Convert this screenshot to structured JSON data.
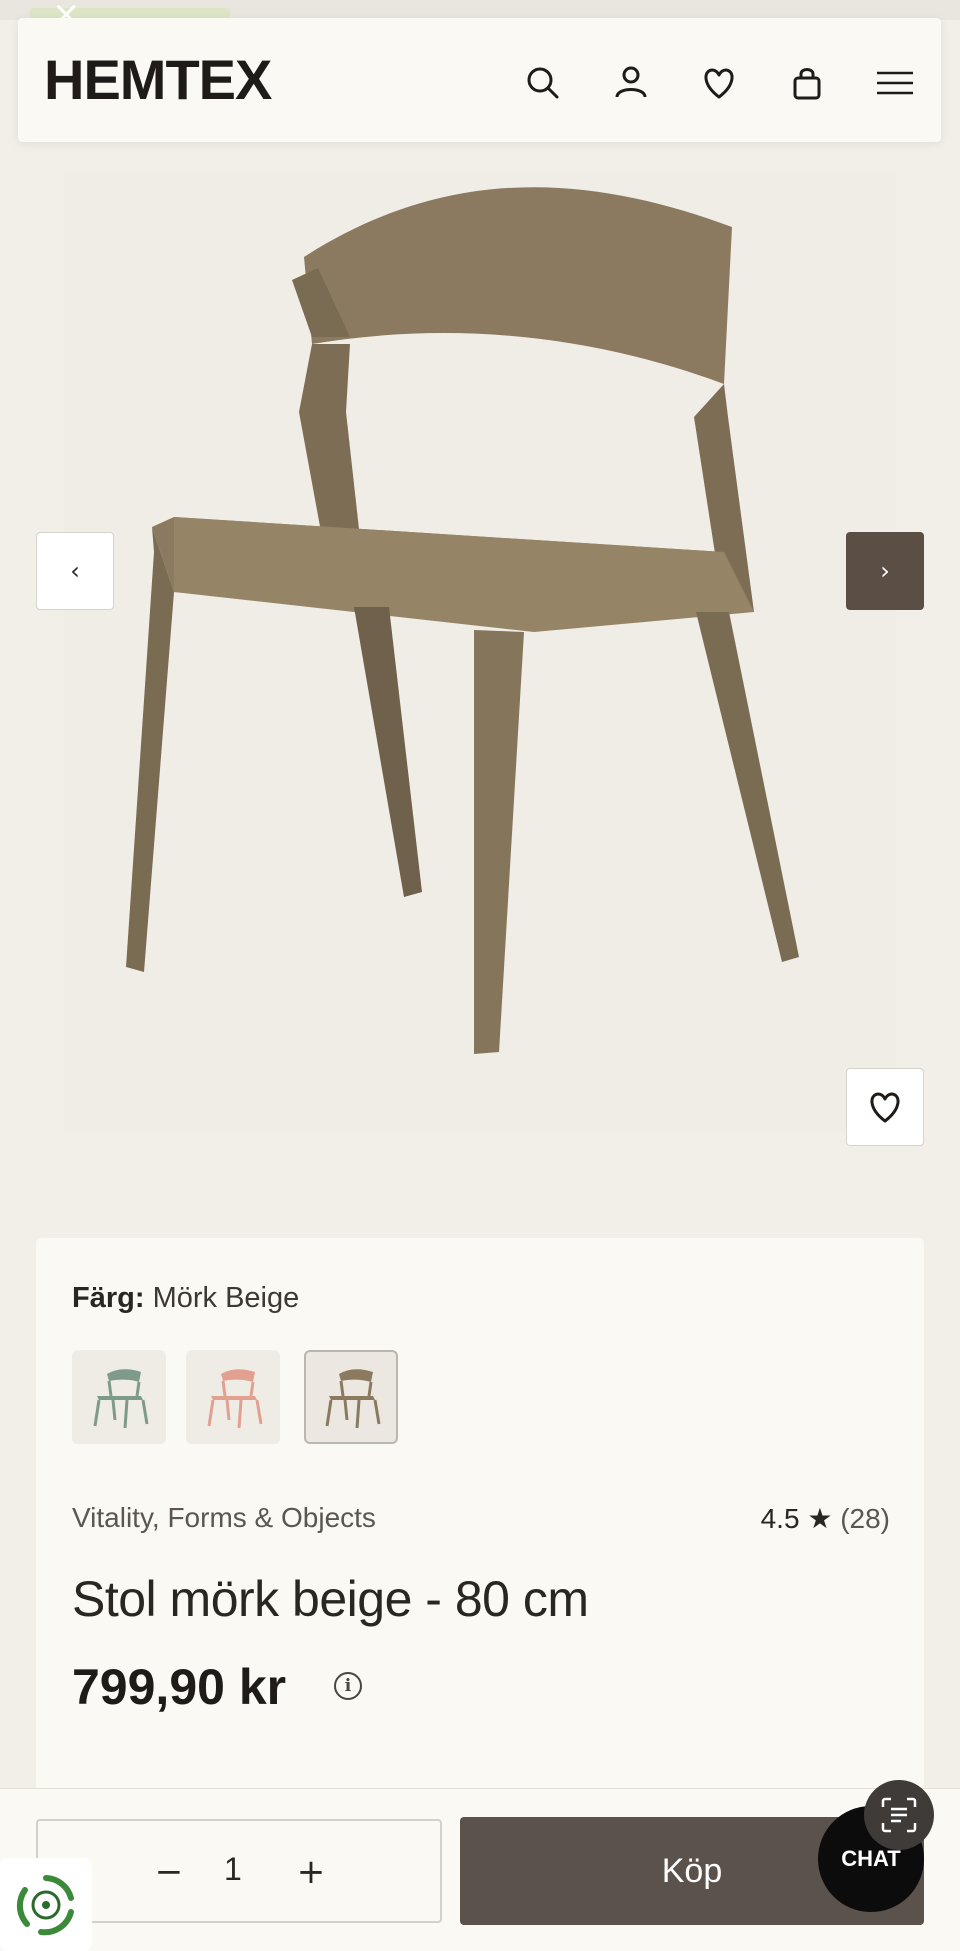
{
  "header": {
    "logo_text": "HEMTEX",
    "icons": [
      "search-icon",
      "account-icon",
      "wishlist-icon",
      "cart-icon",
      "menu-icon"
    ]
  },
  "gallery": {
    "product_image": "chair-dark-beige",
    "prev_icon": "‹",
    "next_icon": "›"
  },
  "product": {
    "color_label": "Färg:",
    "color_value": "Mörk Beige",
    "swatches": [
      {
        "name": "green",
        "color": "#7e9a8a",
        "selected": false
      },
      {
        "name": "pink",
        "color": "#e2a090",
        "selected": false
      },
      {
        "name": "dark-beige",
        "color": "#8b7a60",
        "selected": true
      }
    ],
    "brand": "Vitality, Forms & Objects",
    "rating_value": "4.5",
    "rating_star": "★",
    "rating_count": "(28)",
    "title": "Stol mörk beige - 80 cm",
    "price": "799,90 kr",
    "info_glyph": "i"
  },
  "buy_bar": {
    "qty_minus": "−",
    "qty_value": "1",
    "qty_plus": "+",
    "buy_label": "Köp",
    "chat_label": "CHAT"
  },
  "colors": {
    "chair": "#8b7a60",
    "accent_dark": "#5a524b",
    "background": "#f2efe9",
    "card": "#fbf9f4"
  }
}
